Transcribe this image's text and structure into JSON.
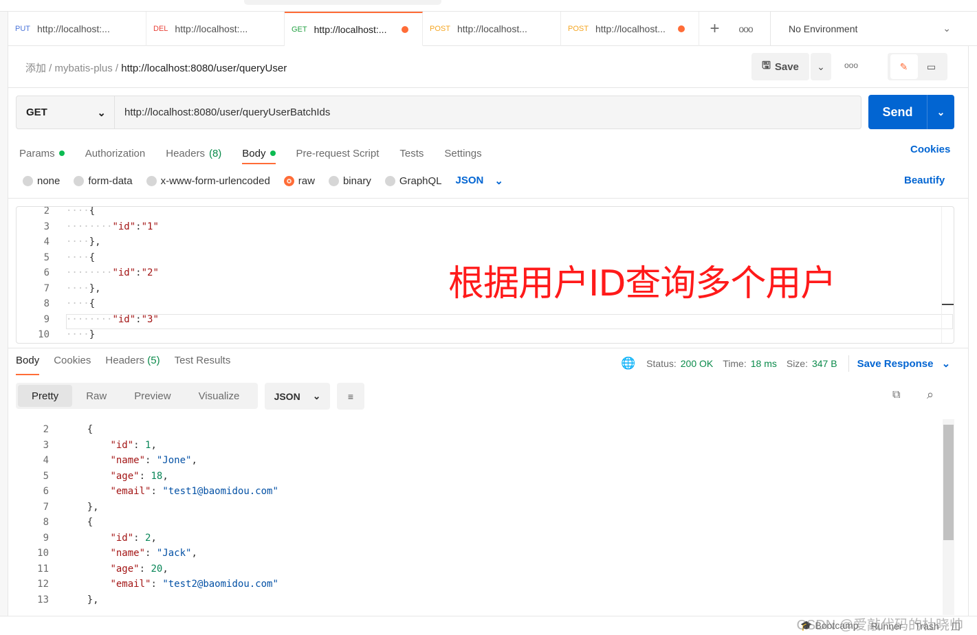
{
  "tabs": [
    {
      "method": "PUT",
      "color": "#4a74d9",
      "url": "http://localhost:...",
      "dirty": false
    },
    {
      "method": "DEL",
      "color": "#e8433a",
      "url": "http://localhost:...",
      "dirty": false
    },
    {
      "method": "GET",
      "color": "#25a244",
      "url": "http://localhost:...",
      "dirty": true
    },
    {
      "method": "POST",
      "color": "#f5a623",
      "url": "http://localhost...",
      "dirty": false
    },
    {
      "method": "POST",
      "color": "#f5a623",
      "url": "http://localhost...",
      "dirty": true
    }
  ],
  "environment": "No Environment",
  "breadcrumb": {
    "collection": "添加",
    "folder": "mybatis-plus",
    "request": "http://localhost:8080/user/queryUser"
  },
  "toolbar": {
    "save": "Save"
  },
  "request": {
    "method": "GET",
    "url": "http://localhost:8080/user/queryUserBatchIds",
    "send": "Send"
  },
  "request_tabs": {
    "params": "Params",
    "authorization": "Authorization",
    "headers": "Headers",
    "headers_count": "(8)",
    "body": "Body",
    "prerequest": "Pre-request Script",
    "tests": "Tests",
    "settings": "Settings",
    "cookies": "Cookies"
  },
  "body_types": {
    "none": "none",
    "form_data": "form-data",
    "urlencoded": "x-www-form-urlencoded",
    "raw": "raw",
    "binary": "binary",
    "graphql": "GraphQL",
    "format": "JSON",
    "beautify": "Beautify"
  },
  "request_body_lines": [
    "2",
    "3",
    "4",
    "5",
    "6",
    "7",
    "8",
    "9",
    "10"
  ],
  "annotation": "根据用户ID查询多个用户",
  "response_tabs": {
    "body": "Body",
    "cookies": "Cookies",
    "headers": "Headers",
    "headers_count": "(5)",
    "test_results": "Test Results"
  },
  "response_status": {
    "status_label": "Status:",
    "status": "200 OK",
    "time_label": "Time:",
    "time": "18 ms",
    "size_label": "Size:",
    "size": "347 B",
    "save_response": "Save Response"
  },
  "view_modes": {
    "pretty": "Pretty",
    "raw": "Raw",
    "preview": "Preview",
    "visualize": "Visualize",
    "format": "JSON"
  },
  "response_lines": [
    "2",
    "3",
    "4",
    "5",
    "6",
    "7",
    "8",
    "9",
    "10",
    "11",
    "12",
    "13"
  ],
  "users": [
    {
      "id": "1",
      "name": "\"Jone\"",
      "age": "18",
      "email": "\"test1@baomidou.com\""
    },
    {
      "id": "2",
      "name": "\"Jack\"",
      "age": "20",
      "email": "\"test2@baomidou.com\""
    }
  ],
  "footer": {
    "bootcamp": "Bootcamp",
    "runner": "Runner",
    "trash": "Trash"
  },
  "watermark": "CSDN @爱敲代码的杜晓帅"
}
